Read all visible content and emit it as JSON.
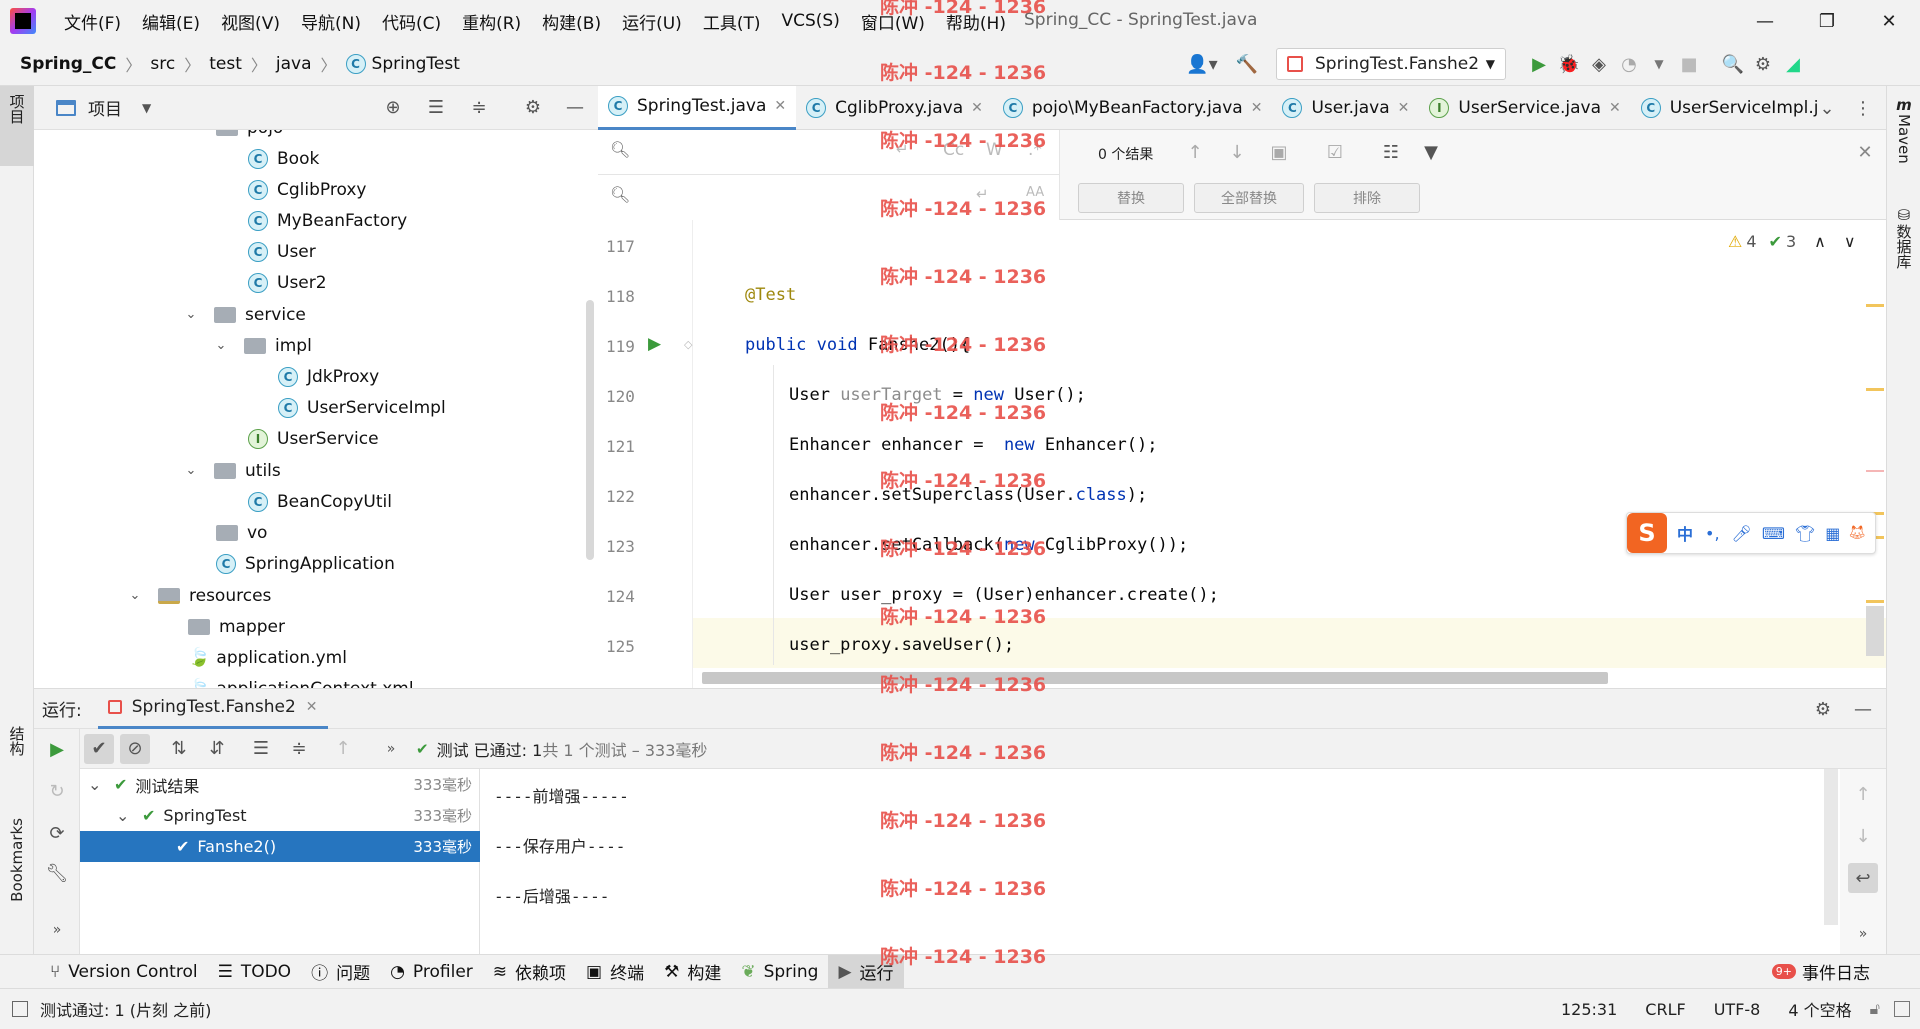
{
  "window": {
    "title": "Spring_CC - SpringTest.java",
    "menu": [
      "文件(F)",
      "编辑(E)",
      "视图(V)",
      "导航(N)",
      "代码(C)",
      "重构(R)",
      "构建(B)",
      "运行(U)",
      "工具(T)",
      "VCS(S)",
      "窗口(W)",
      "帮助(H)"
    ]
  },
  "breadcrumb": [
    "Spring_CC",
    "src",
    "test",
    "java",
    "SpringTest"
  ],
  "run_config": {
    "label": "SpringTest.Fanshe2"
  },
  "left_stripe": {
    "project": "项目",
    "structure": "结构",
    "bookmarks": "Bookmarks"
  },
  "right_stripe": {
    "maven": "Maven",
    "database": "数据库"
  },
  "project_panel": {
    "title": "项目",
    "items": [
      {
        "label": "pojo",
        "kind": "folder"
      },
      {
        "label": "Book",
        "kind": "class"
      },
      {
        "label": "CglibProxy",
        "kind": "class"
      },
      {
        "label": "MyBeanFactory",
        "kind": "class"
      },
      {
        "label": "User",
        "kind": "class"
      },
      {
        "label": "User2",
        "kind": "class"
      },
      {
        "label": "service",
        "kind": "folder"
      },
      {
        "label": "impl",
        "kind": "folder"
      },
      {
        "label": "JdkProxy",
        "kind": "class"
      },
      {
        "label": "UserServiceImpl",
        "kind": "class"
      },
      {
        "label": "UserService",
        "kind": "interface"
      },
      {
        "label": "utils",
        "kind": "folder"
      },
      {
        "label": "BeanCopyUtil",
        "kind": "class"
      },
      {
        "label": "vo",
        "kind": "folder"
      },
      {
        "label": "SpringApplication",
        "kind": "class"
      },
      {
        "label": "resources",
        "kind": "folder"
      },
      {
        "label": "mapper",
        "kind": "folder"
      },
      {
        "label": "application.yml",
        "kind": "file"
      },
      {
        "label": "applicationContext.xml",
        "kind": "file"
      }
    ]
  },
  "editor_tabs": [
    {
      "label": "SpringTest.java",
      "icon": "C",
      "active": true
    },
    {
      "label": "CglibProxy.java",
      "icon": "C"
    },
    {
      "label": "pojo\\MyBeanFactory.java",
      "icon": "C"
    },
    {
      "label": "User.java",
      "icon": "C"
    },
    {
      "label": "UserService.java",
      "icon": "I"
    },
    {
      "label": "UserServiceImpl.j",
      "icon": "C"
    }
  ],
  "find": {
    "results": "0 个结果",
    "replace": "替换",
    "replace_all": "全部替换",
    "exclude": "排除",
    "case_label": "Cc",
    "word_label": "W",
    "regex_label": ".*"
  },
  "inspections": {
    "warnings": "4",
    "checks": "3"
  },
  "code": {
    "line_numbers": [
      "117",
      "118",
      "119",
      "120",
      "121",
      "122",
      "123",
      "124",
      "125"
    ],
    "l118": "@Test",
    "l119_kw": "public void ",
    "l119_rest": "Fanshe2(){",
    "l120_a": "User ",
    "l120_var": "userTarget",
    "l120_b": " = ",
    "l120_kw": "new",
    "l120_c": " User();",
    "l121_a": "Enhancer enhancer =  ",
    "l121_kw": "new",
    "l121_c": " Enhancer();",
    "l122_a": "enhancer.setSuperclass(User.",
    "l122_kw": "class",
    "l122_c": ");",
    "l123_a": "enhancer.setCallback(",
    "l123_kw": "new",
    "l123_c": " CglibProxy());",
    "l124": "User user_proxy = (User)enhancer.create();",
    "l125": "user_proxy.saveUser();"
  },
  "run": {
    "label": "运行:",
    "tab": "SpringTest.Fanshe2",
    "status_prefix": "测试 已通过: 1",
    "status_suffix": "共 1 个测试 – 333毫秒",
    "tree": [
      {
        "label": "测试结果",
        "time": "333毫秒"
      },
      {
        "label": "SpringTest",
        "time": "333毫秒"
      },
      {
        "label": "Fanshe2()",
        "time": "333毫秒"
      }
    ],
    "console": [
      "----前增强-----",
      "---保存用户----",
      "---后增强----"
    ]
  },
  "bottom_tabs": [
    "Version Control",
    "TODO",
    "问题",
    "Profiler",
    "依赖项",
    "终端",
    "构建",
    "Spring",
    "运行"
  ],
  "event_log": {
    "label": "事件日志",
    "badge": "9+"
  },
  "status": {
    "message": "测试通过: 1 (片刻 之前)",
    "position": "125:31",
    "line_sep": "CRLF",
    "encoding": "UTF-8",
    "indent": "4 个空格"
  },
  "watermark": "陈冲 -124 - 1236",
  "colors": {
    "accent": "#4a86c7",
    "selection": "#2675bf",
    "pass": "#3c9a3c",
    "watermark": "#e8504a"
  }
}
